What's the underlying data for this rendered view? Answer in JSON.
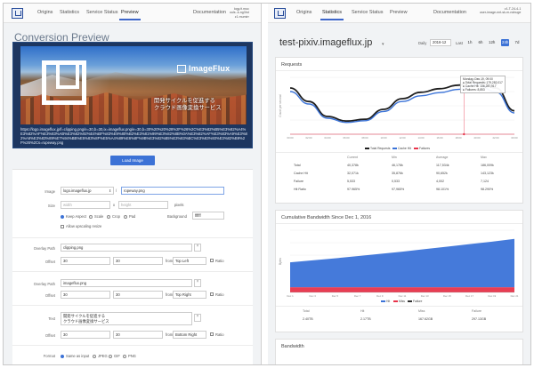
{
  "left": {
    "nav": {
      "items": [
        "Origins",
        "Statistics",
        "Service Status",
        "Preview"
      ],
      "active": "Preview",
      "documentation": "Documentation",
      "user_line1": "logy.it.muc",
      "user_line2": "ouls.-k-ng3hd",
      "user_line3": "z1.mumirr"
    },
    "title": "Conversion Preview",
    "preview": {
      "brand": "ImageFlux",
      "overlay_text": "開発サイクルを促進する\nクラウド画像変換サービス",
      "url": "https://logo.imageflux.jp/f=clipping.png/e=30,b=30,ix=imageflux.png/e=30,b=30%20%20%28%2F%26%2C%E3%82%B5%E3%82%A4%E3%82%AF%E3%83%AB%E3%82%92%E4%BF%83%E9%80%B2%E3%81%99%E3%82%8B%0A%E3%82%AF%E3%83%A9%E3%82%A6%E3%83%89%E7%94%BB%E5%83%8F%E5%A4%89%E6%8F%9B%E3%82%B5%E3%83%BC%E3%83%93%E3%82%B9%2F%26%2Cs=rupeway.png"
    },
    "load_button": "Load Image",
    "form": {
      "image_label": "Image",
      "image_domain": "logo.imageflux.jp",
      "image_path": "ropeway.png",
      "size_label": "Size",
      "width_placeholder": "width",
      "x": "x",
      "height_placeholder": "height",
      "pixels": "pixels",
      "modes": [
        "Keep Aspect",
        "Scale",
        "Crop",
        "Pad"
      ],
      "background_label": "Background",
      "background_value": "ffffff",
      "allow_upscaling": "Allow upscaling resize",
      "overlay1_label": "Overlay Path",
      "overlay1_path": "clipping.png",
      "offset_label": "Offset",
      "overlay1_offset_x": "30",
      "overlay1_offset_y": "30",
      "from_label": "from",
      "overlay1_from": "Top Left",
      "ratio": "Ratio",
      "overlay2_label": "Overlay Path",
      "overlay2_path": "imageflux.png",
      "overlay2_offset_x": "30",
      "overlay2_offset_y": "30",
      "overlay2_from": "Top Right",
      "text_label": "Text",
      "text_value": "開発サイクルを促進する\nクラウド画像変換サービス",
      "text_offset_x": "30",
      "text_offset_y": "30",
      "text_from": "Bottom Right",
      "format_label": "Format",
      "formats": [
        "Same as input",
        "JPEG",
        "GIF",
        "PNG"
      ]
    }
  },
  "right": {
    "nav": {
      "items": [
        "Origins",
        "Statistics",
        "Service Status",
        "Preview"
      ],
      "active": "Statistics",
      "documentation": "Documentation",
      "user_line1": "v1-T-24-4-1",
      "user_line2": "user-image-nnt-sk-m-ndnuge"
    },
    "title": "test-pixiv.imageflux.jp",
    "daily_label": "Daily",
    "daily_value": "2016-12",
    "last_label": "Last",
    "range_buttons": [
      "1h",
      "6h",
      "12h",
      "24h",
      "7d"
    ],
    "range_active": "24h",
    "requests": {
      "title": "Requests",
      "tooltip": "Monday, Dec 19, 09:00\n● Total Requests: 179,282,017\n● Cache Hit: 136,287,917\n● Failures: 8,853",
      "legend": [
        "Total Requests",
        "Cache Hit",
        "Failures"
      ],
      "table_headers": [
        "",
        "Current",
        "Min",
        "Average",
        "Max"
      ],
      "table_rows": [
        [
          "Total",
          "40,378k",
          "46,178k",
          "117,534k",
          "186,009k"
        ],
        [
          "Cache Hit",
          "32,071k",
          "35,876k",
          "90,652k",
          "143,123k"
        ],
        [
          "Failure",
          "5,533",
          "0,533",
          "4,002",
          "7,124"
        ],
        [
          "Hit Ratio",
          "97.965%",
          "97,965%",
          "98.101%",
          "98.290%"
        ]
      ]
    },
    "bandwidth_cumulative": {
      "title": "Cumulative Bandwidth Since Dec 1, 2016",
      "legend": [
        "Hit",
        "Miss",
        "Failure"
      ],
      "table_headers": [
        "Total",
        "Hit",
        "Miss",
        "Failure"
      ],
      "table_row": [
        "2.40TB",
        "2.17TB",
        "167.62GB",
        "297.13GB"
      ]
    },
    "bandwidth": {
      "title": "Bandwidth"
    }
  },
  "colors": {
    "accent": "#3c72d6",
    "total_series": "#1f1f1f",
    "cache_series": "#3b73d8",
    "failure_series": "#e8334a"
  },
  "chart_data": [
    {
      "type": "line",
      "title": "Requests",
      "ylabel": "Count per second",
      "x": [
        "00:00",
        "02:00",
        "04:00",
        "06:00",
        "08:00",
        "10:00",
        "12:00",
        "14:00",
        "16:00",
        "18:00",
        "20:00",
        "22:00",
        "00:00"
      ],
      "series": [
        {
          "name": "Total Requests",
          "values": [
            130,
            92,
            50,
            37,
            42,
            70,
            100,
            118,
            128,
            138,
            155,
            130,
            66
          ]
        },
        {
          "name": "Cache Hit",
          "values": [
            120,
            85,
            45,
            33,
            38,
            64,
            92,
            108,
            117,
            126,
            140,
            119,
            60
          ]
        },
        {
          "name": "Failures",
          "values": [
            0,
            0,
            0,
            0,
            0,
            0,
            0,
            0,
            0,
            0,
            0,
            0,
            0
          ]
        }
      ],
      "ylim": [
        0,
        160
      ],
      "legend": "bottom"
    },
    {
      "type": "area",
      "title": "Cumulative Bandwidth Since Dec 1, 2016",
      "ylabel": "Bytes",
      "x": [
        "Dec 1",
        "Dec 3",
        "Dec 5",
        "Dec 7",
        "Dec 9",
        "Dec 11",
        "Dec 13",
        "Dec 15",
        "Dec 17",
        "Dec 19",
        "Dec 21"
      ],
      "series": [
        {
          "name": "Hit",
          "values": [
            1.0,
            1.08,
            1.16,
            1.25,
            1.34,
            1.43,
            1.53,
            1.63,
            1.73,
            1.83,
            1.94
          ]
        },
        {
          "name": "Miss",
          "values": [
            0.2,
            0.2,
            0.2,
            0.2,
            0.2,
            0.2,
            0.2,
            0.2,
            0.2,
            0.2,
            0.2
          ]
        },
        {
          "name": "Failure",
          "values": [
            0.01,
            0.01,
            0.01,
            0.01,
            0.01,
            0.01,
            0.01,
            0.01,
            0.01,
            0.01,
            0.01
          ]
        }
      ],
      "ylim": [
        0,
        2.5
      ],
      "legend": "bottom"
    }
  ]
}
